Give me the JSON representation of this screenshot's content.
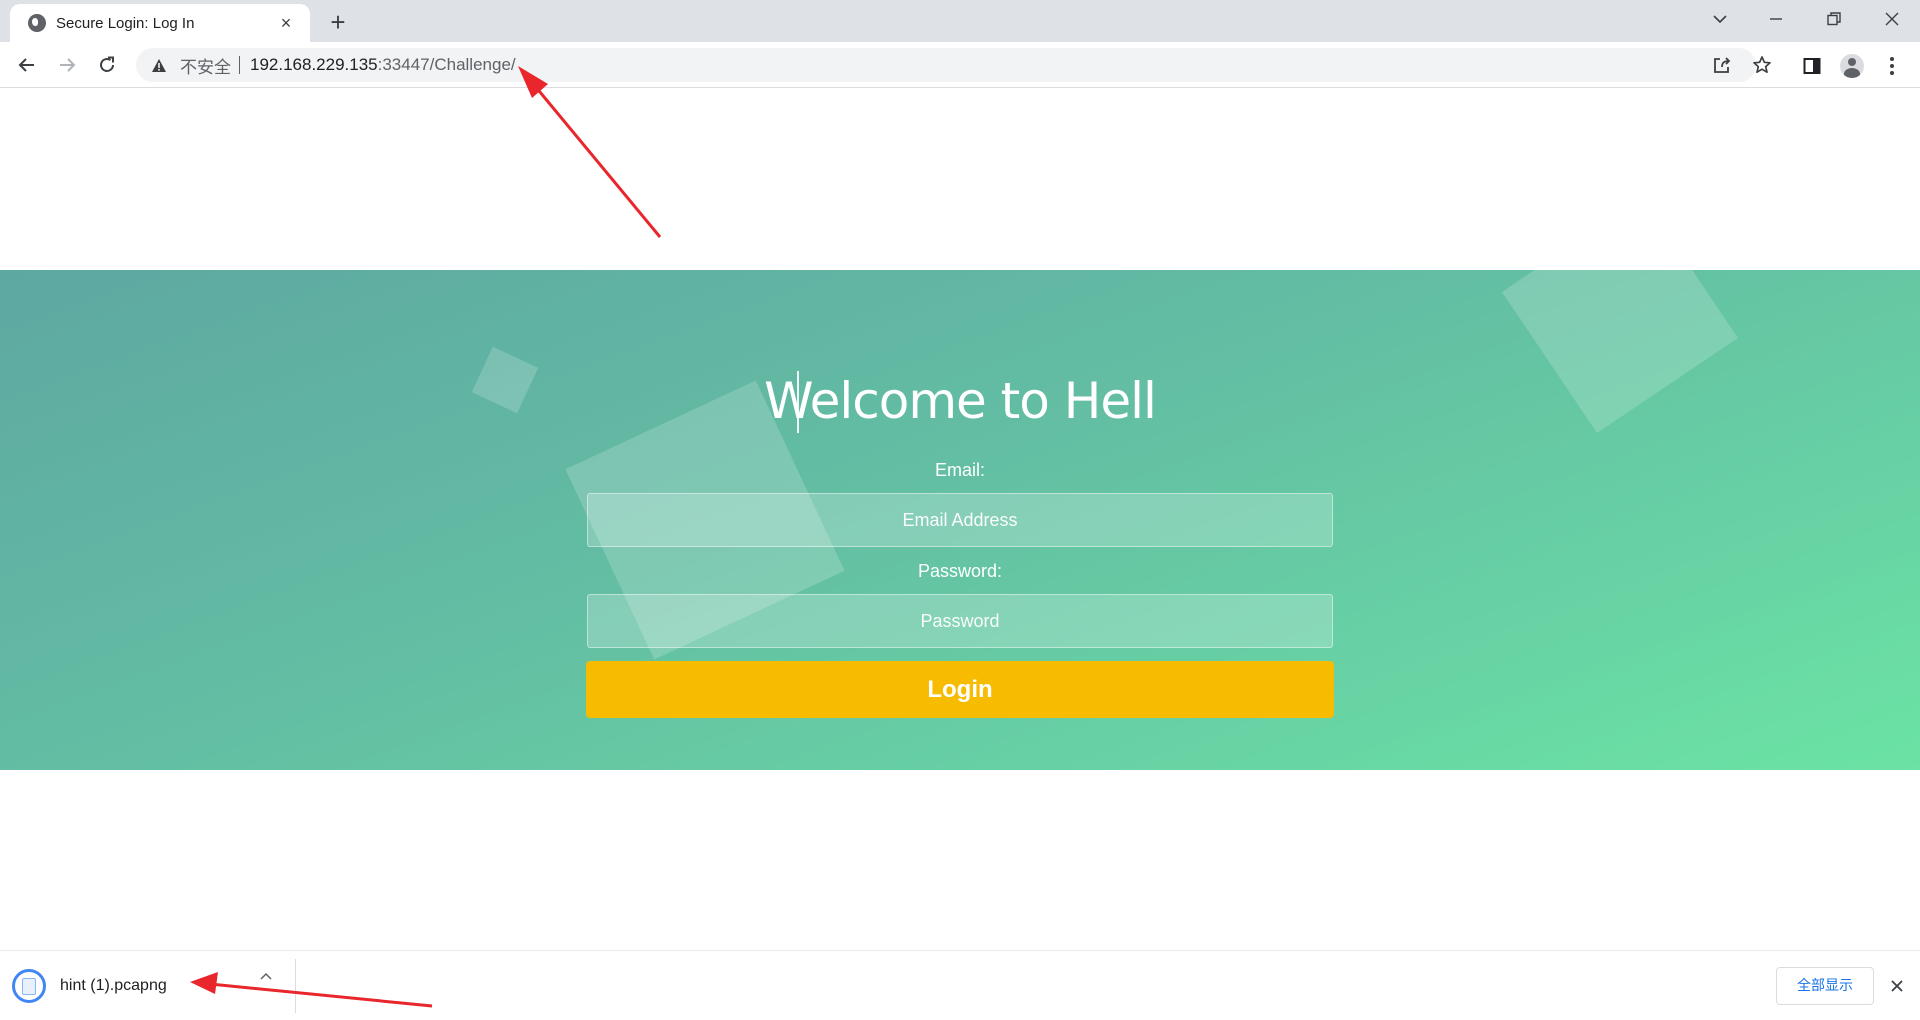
{
  "browser": {
    "tab_title": "Secure Login: Log In",
    "tab_close_glyph": "×",
    "new_tab_glyph": "+",
    "omnibox": {
      "security_text": "不安全",
      "url_host": "192.168.229.135",
      "url_rest": ":33447/Challenge/"
    }
  },
  "page": {
    "heading": "Welcome to Hell",
    "email_label": "Email:",
    "email_placeholder": "Email Address",
    "password_label": "Password:",
    "password_placeholder": "Password",
    "login_label": "Login",
    "colors": {
      "gradient_start": "#5ea8a2",
      "gradient_end": "#6be3a4",
      "button": "#f7bc00"
    }
  },
  "downloads": {
    "file_name": "hint (1).pcapng",
    "show_all_label": "全部显示"
  },
  "annotations": {
    "arrow_color": "#e8262b"
  },
  "icons": [
    "globe-icon",
    "close-icon",
    "plus-icon",
    "chevron-down-icon",
    "minimize-icon",
    "restore-icon",
    "back-arrow-icon",
    "forward-arrow-icon",
    "reload-icon",
    "warning-icon",
    "share-icon",
    "star-icon",
    "side-panel-icon",
    "profile-avatar-icon",
    "kebab-menu-icon",
    "file-icon",
    "chevron-up-icon"
  ]
}
